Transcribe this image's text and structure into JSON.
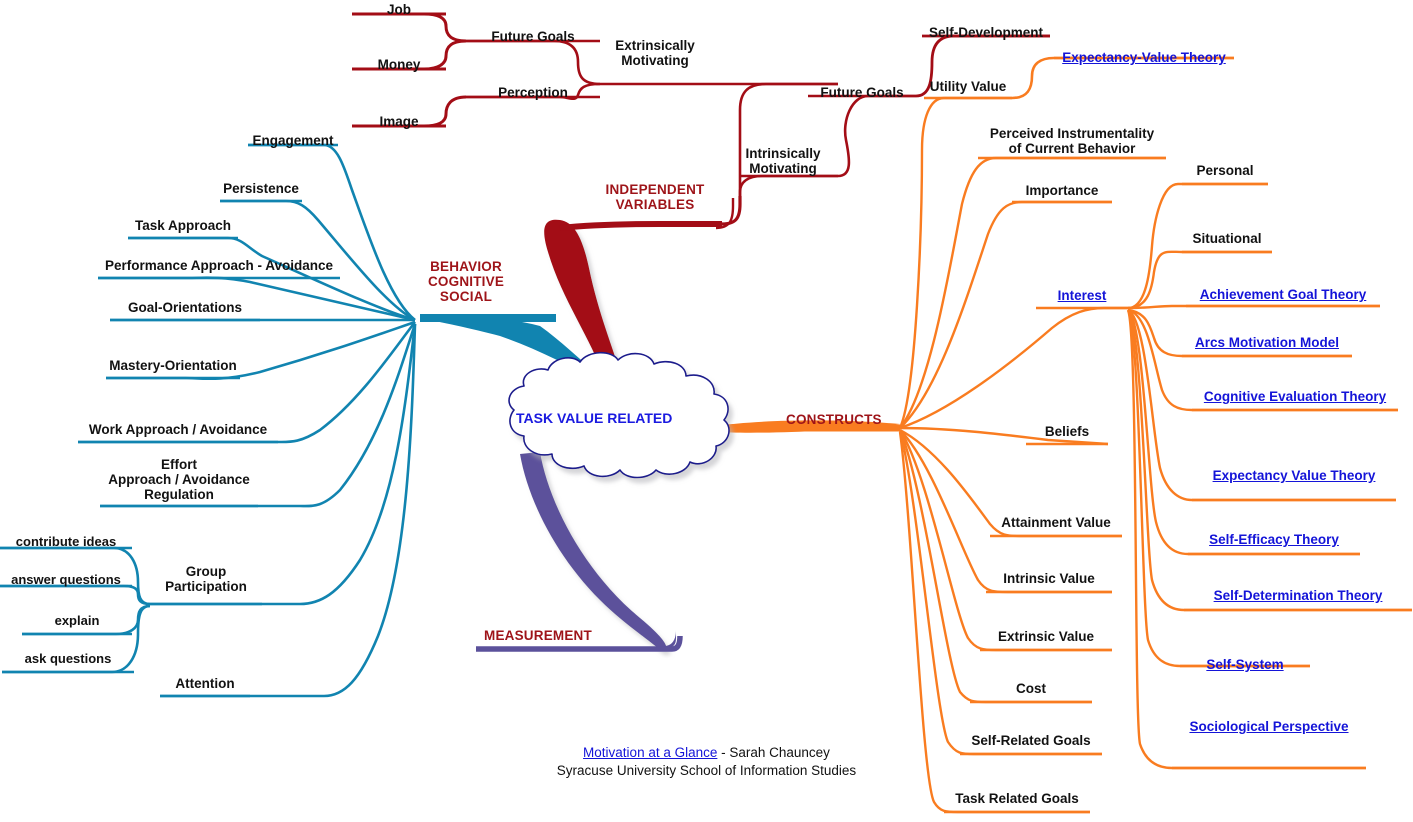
{
  "title": "Motivation at a Glance",
  "colors": {
    "dark_red_branch": "#9e0b14",
    "teal_branch": "#1184b0",
    "orange_branch": "#f97c20",
    "purple_branch": "#5b519b",
    "red_caption": "#9e1419",
    "hyperlink_blue": "#1414d8",
    "cloud_text_blue": "#1a1ae0",
    "label_black": "#121212"
  },
  "center": {
    "label": "TASK VALUE RELATED"
  },
  "main_branches": [
    {
      "id": "independent-variables",
      "label": "INDEPENDENT VARIABLES",
      "color": "#9e1419"
    },
    {
      "id": "behavior-cognitive-social",
      "label": "BEHAVIOR COGNITIVE SOCIAL",
      "color": "#9e1419"
    },
    {
      "id": "constructs",
      "label": "CONSTRUCTS",
      "color": "#9e1419"
    },
    {
      "id": "measurement",
      "label": "MEASUREMENT",
      "color": "#9e1419"
    }
  ],
  "independent_variables": {
    "caption_line1": "INDEPENDENT",
    "caption_line2": "VARIABLES",
    "children": [
      {
        "label_line1": "Extrinsically",
        "label_line2": "Motivating",
        "children": [
          {
            "label": "Future Goals",
            "children": [
              {
                "label": "Job"
              },
              {
                "label": "Money"
              }
            ]
          },
          {
            "label": "Perception",
            "children": [
              {
                "label": "Image"
              }
            ]
          }
        ]
      },
      {
        "label_line1": "Intrinsically",
        "label_line2": "Motivating",
        "children": [
          {
            "label": "Future Goals",
            "children": [
              {
                "label": "Self-Development"
              }
            ]
          }
        ]
      }
    ]
  },
  "behavior_cognitive_social": {
    "caption_line1": "BEHAVIOR",
    "caption_line2": "COGNITIVE",
    "caption_line3": "SOCIAL",
    "children": [
      {
        "label": "Engagement"
      },
      {
        "label": "Persistence"
      },
      {
        "label": "Task Approach"
      },
      {
        "label": "Performance Approach - Avoidance"
      },
      {
        "label": "Goal-Orientations"
      },
      {
        "label": "Mastery-Orientation"
      },
      {
        "label": "Work Approach / Avoidance"
      },
      {
        "label_line1": "Effort",
        "label_line2": "Approach / Avoidance",
        "label_line3": "Regulation"
      },
      {
        "label_line1": "Group",
        "label_line2": "Participation",
        "children": [
          {
            "label": "contribute ideas"
          },
          {
            "label": "answer questions"
          },
          {
            "label": "explain"
          },
          {
            "label": "ask questions"
          }
        ]
      },
      {
        "label": "Attention"
      }
    ]
  },
  "constructs": {
    "caption": "CONSTRUCTS",
    "children": [
      {
        "label": "Utility Value",
        "children": [
          {
            "label": "Expectancy-Value Theory",
            "link": true
          }
        ]
      },
      {
        "label_line1": "Perceived Instrumentality",
        "label_line2": "of Current Behavior"
      },
      {
        "label": "Importance"
      },
      {
        "label": "Interest",
        "link": true,
        "children": [
          {
            "label": "Personal",
            "link": false
          },
          {
            "label": "Situational",
            "link": false
          },
          {
            "label": "Achievement Goal Theory",
            "link": true
          },
          {
            "label": "Arcs Motivation Model",
            "link": true
          },
          {
            "label": "Cognitive Evaluation Theory",
            "link": true
          },
          {
            "label": "Expectancy Value Theory",
            "link": true
          },
          {
            "label": "Self-Efficacy Theory",
            "link": true
          },
          {
            "label": "Self-Determination Theory",
            "link": true
          },
          {
            "label": "Self-System",
            "link": true
          },
          {
            "label": "Sociological Perspective",
            "link": true
          }
        ]
      },
      {
        "label": "Beliefs"
      },
      {
        "label": "Attainment Value"
      },
      {
        "label": "Intrinsic Value"
      },
      {
        "label": "Extrinsic Value"
      },
      {
        "label": "Cost"
      },
      {
        "label": "Self-Related Goals"
      },
      {
        "label": "Task Related Goals"
      }
    ]
  },
  "measurement": {
    "caption": "MEASUREMENT"
  },
  "footer": {
    "link_text": "Motivation at a Glance",
    "author_text": " - Sarah Chauncey",
    "affiliation": "Syracuse University School of Information Studies"
  }
}
